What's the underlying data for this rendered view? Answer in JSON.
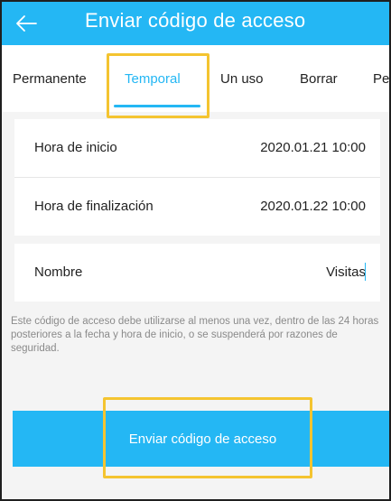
{
  "header": {
    "title": "Enviar código de acceso",
    "back_icon": "arrow-left-icon"
  },
  "tabs": [
    {
      "label": "Permanente",
      "active": false
    },
    {
      "label": "Temporal",
      "active": true
    },
    {
      "label": "Un uso",
      "active": false
    },
    {
      "label": "Borrar",
      "active": false
    },
    {
      "label": "Pe",
      "active": false
    }
  ],
  "form": {
    "start": {
      "label": "Hora de inicio",
      "value": "2020.01.21 10:00"
    },
    "end": {
      "label": "Hora de finalización",
      "value": "2020.01.22 10:00"
    },
    "name": {
      "label": "Nombre",
      "value": "Visitas"
    }
  },
  "note": "Este código de acceso debe utilizarse al menos una vez, dentro de las 24 horas posteriores a la fecha y hora de inicio, o se suspenderá por razones de seguridad.",
  "submit_label": "Enviar código de acceso",
  "colors": {
    "accent": "#24b7f4",
    "highlight": "#f4c430"
  }
}
